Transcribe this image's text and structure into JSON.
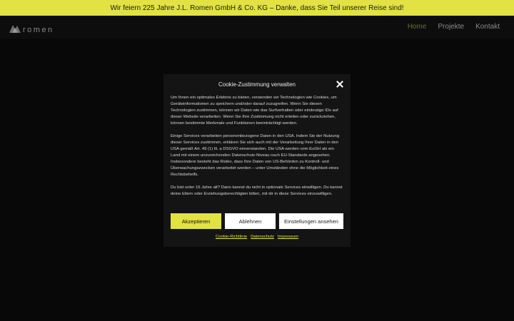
{
  "banner": {
    "text": "Wir feiern 225 Jahre J.L. Romen GmbH & Co. KG – Danke, dass Sie Teil unserer Reise sind!"
  },
  "header": {
    "logo_text": "romen",
    "nav": [
      {
        "label": "Home",
        "active": true
      },
      {
        "label": "Projekte",
        "active": false
      },
      {
        "label": "Kontakt",
        "active": false
      }
    ]
  },
  "cookie_dialog": {
    "title": "Cookie-Zustimmung verwalten",
    "paragraphs": [
      "Um Ihnen ein optimales Erlebnis zu bieten, verwenden wir Technologien wie Cookies, um Geräteinformationen zu speichern und/oder darauf zuzugreifen. Wenn Sie diesen Technologien zustimmen, können wir Daten wie das Surfverhalten oder eindeutige IDs auf dieser Website verarbeiten. Wenn Sie Ihre Zustimmung nicht erteilen oder zurückziehen, können bestimmte Merkmale und Funktionen beeinträchtigt werden.",
      "Einige Services verarbeiten personenbezogene Daten in den USA. Indem Sie der Nutzung dieser Services zustimmen, erklären Sie sich auch mit der Verarbeitung Ihrer Daten in den USA gemäß Art. 49 (1) lit. a DSGVO einverstanden. Die USA werden vom EuGH als ein Land mit einem unzureichenden Datenschutz-Niveau nach EU-Standards angesehen. Insbesondere besteht das Risiko, dass Ihre Daten von US-Behörden zu Kontroll- und Überwachungszwecken verarbeitet werden – unter Umständen ohne die Möglichkeit eines Rechtsbehelfs.",
      "Du bist unter 16 Jahre alt? Dann kannst du nicht in optionale Services einwilligen. Du kannst deine Eltern oder Erziehungsberechtigten bitten, mit dir in diese Services einzuwilligen."
    ],
    "buttons": {
      "accept": "Akzeptieren",
      "deny": "Ablehnen",
      "preferences": "Einstellungen ansehen"
    },
    "links": [
      "Cookie-Richtlinie",
      "Datenschutz",
      "Impressum"
    ]
  },
  "colors": {
    "accent": "#e2e244",
    "background": "#050505",
    "dialog": "#141414"
  }
}
